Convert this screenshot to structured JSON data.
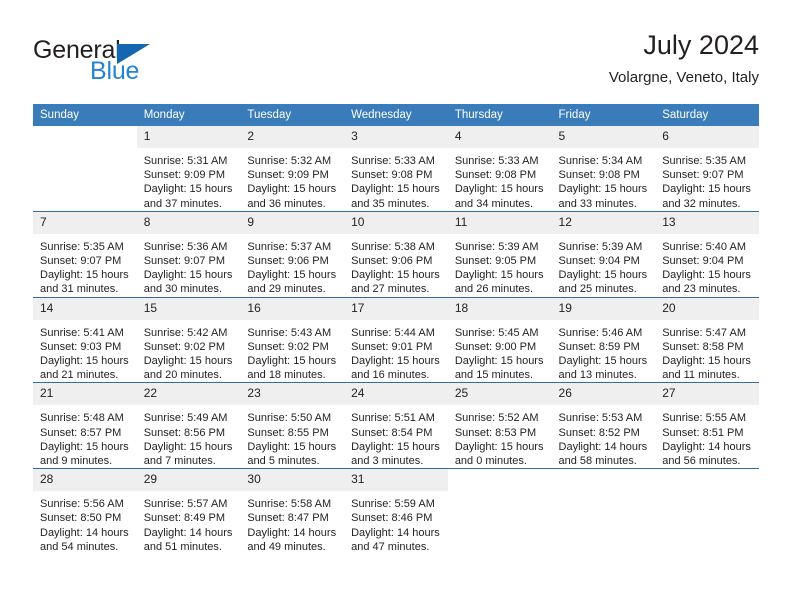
{
  "brand": {
    "name_part1": "General",
    "name_part2": "Blue",
    "triangle_color": "#1565b0",
    "blue_text_color": "#2583d4"
  },
  "header": {
    "title": "July 2024",
    "location": "Volargne, Veneto, Italy"
  },
  "theme": {
    "header_blue": "#3a7cba",
    "separator_blue": "#2f6ca8",
    "daynum_band": "#efefef",
    "text": "#231f20"
  },
  "calendar": {
    "weekday_headers": [
      "Sunday",
      "Monday",
      "Tuesday",
      "Wednesday",
      "Thursday",
      "Friday",
      "Saturday"
    ],
    "labels": {
      "sunrise_prefix": "Sunrise:",
      "sunset_prefix": "Sunset:",
      "daylight_prefix": "Daylight:"
    },
    "weeks": [
      [
        {
          "day": "",
          "empty": true
        },
        {
          "day": "1",
          "sunrise": "Sunrise: 5:31 AM",
          "sunset": "Sunset: 9:09 PM",
          "daylight_line1": "Daylight: 15 hours",
          "daylight_line2": "and 37 minutes."
        },
        {
          "day": "2",
          "sunrise": "Sunrise: 5:32 AM",
          "sunset": "Sunset: 9:09 PM",
          "daylight_line1": "Daylight: 15 hours",
          "daylight_line2": "and 36 minutes."
        },
        {
          "day": "3",
          "sunrise": "Sunrise: 5:33 AM",
          "sunset": "Sunset: 9:08 PM",
          "daylight_line1": "Daylight: 15 hours",
          "daylight_line2": "and 35 minutes."
        },
        {
          "day": "4",
          "sunrise": "Sunrise: 5:33 AM",
          "sunset": "Sunset: 9:08 PM",
          "daylight_line1": "Daylight: 15 hours",
          "daylight_line2": "and 34 minutes."
        },
        {
          "day": "5",
          "sunrise": "Sunrise: 5:34 AM",
          "sunset": "Sunset: 9:08 PM",
          "daylight_line1": "Daylight: 15 hours",
          "daylight_line2": "and 33 minutes."
        },
        {
          "day": "6",
          "sunrise": "Sunrise: 5:35 AM",
          "sunset": "Sunset: 9:07 PM",
          "daylight_line1": "Daylight: 15 hours",
          "daylight_line2": "and 32 minutes."
        }
      ],
      [
        {
          "day": "7",
          "sunrise": "Sunrise: 5:35 AM",
          "sunset": "Sunset: 9:07 PM",
          "daylight_line1": "Daylight: 15 hours",
          "daylight_line2": "and 31 minutes."
        },
        {
          "day": "8",
          "sunrise": "Sunrise: 5:36 AM",
          "sunset": "Sunset: 9:07 PM",
          "daylight_line1": "Daylight: 15 hours",
          "daylight_line2": "and 30 minutes."
        },
        {
          "day": "9",
          "sunrise": "Sunrise: 5:37 AM",
          "sunset": "Sunset: 9:06 PM",
          "daylight_line1": "Daylight: 15 hours",
          "daylight_line2": "and 29 minutes."
        },
        {
          "day": "10",
          "sunrise": "Sunrise: 5:38 AM",
          "sunset": "Sunset: 9:06 PM",
          "daylight_line1": "Daylight: 15 hours",
          "daylight_line2": "and 27 minutes."
        },
        {
          "day": "11",
          "sunrise": "Sunrise: 5:39 AM",
          "sunset": "Sunset: 9:05 PM",
          "daylight_line1": "Daylight: 15 hours",
          "daylight_line2": "and 26 minutes."
        },
        {
          "day": "12",
          "sunrise": "Sunrise: 5:39 AM",
          "sunset": "Sunset: 9:04 PM",
          "daylight_line1": "Daylight: 15 hours",
          "daylight_line2": "and 25 minutes."
        },
        {
          "day": "13",
          "sunrise": "Sunrise: 5:40 AM",
          "sunset": "Sunset: 9:04 PM",
          "daylight_line1": "Daylight: 15 hours",
          "daylight_line2": "and 23 minutes."
        }
      ],
      [
        {
          "day": "14",
          "sunrise": "Sunrise: 5:41 AM",
          "sunset": "Sunset: 9:03 PM",
          "daylight_line1": "Daylight: 15 hours",
          "daylight_line2": "and 21 minutes."
        },
        {
          "day": "15",
          "sunrise": "Sunrise: 5:42 AM",
          "sunset": "Sunset: 9:02 PM",
          "daylight_line1": "Daylight: 15 hours",
          "daylight_line2": "and 20 minutes."
        },
        {
          "day": "16",
          "sunrise": "Sunrise: 5:43 AM",
          "sunset": "Sunset: 9:02 PM",
          "daylight_line1": "Daylight: 15 hours",
          "daylight_line2": "and 18 minutes."
        },
        {
          "day": "17",
          "sunrise": "Sunrise: 5:44 AM",
          "sunset": "Sunset: 9:01 PM",
          "daylight_line1": "Daylight: 15 hours",
          "daylight_line2": "and 16 minutes."
        },
        {
          "day": "18",
          "sunrise": "Sunrise: 5:45 AM",
          "sunset": "Sunset: 9:00 PM",
          "daylight_line1": "Daylight: 15 hours",
          "daylight_line2": "and 15 minutes."
        },
        {
          "day": "19",
          "sunrise": "Sunrise: 5:46 AM",
          "sunset": "Sunset: 8:59 PM",
          "daylight_line1": "Daylight: 15 hours",
          "daylight_line2": "and 13 minutes."
        },
        {
          "day": "20",
          "sunrise": "Sunrise: 5:47 AM",
          "sunset": "Sunset: 8:58 PM",
          "daylight_line1": "Daylight: 15 hours",
          "daylight_line2": "and 11 minutes."
        }
      ],
      [
        {
          "day": "21",
          "sunrise": "Sunrise: 5:48 AM",
          "sunset": "Sunset: 8:57 PM",
          "daylight_line1": "Daylight: 15 hours",
          "daylight_line2": "and 9 minutes."
        },
        {
          "day": "22",
          "sunrise": "Sunrise: 5:49 AM",
          "sunset": "Sunset: 8:56 PM",
          "daylight_line1": "Daylight: 15 hours",
          "daylight_line2": "and 7 minutes."
        },
        {
          "day": "23",
          "sunrise": "Sunrise: 5:50 AM",
          "sunset": "Sunset: 8:55 PM",
          "daylight_line1": "Daylight: 15 hours",
          "daylight_line2": "and 5 minutes."
        },
        {
          "day": "24",
          "sunrise": "Sunrise: 5:51 AM",
          "sunset": "Sunset: 8:54 PM",
          "daylight_line1": "Daylight: 15 hours",
          "daylight_line2": "and 3 minutes."
        },
        {
          "day": "25",
          "sunrise": "Sunrise: 5:52 AM",
          "sunset": "Sunset: 8:53 PM",
          "daylight_line1": "Daylight: 15 hours",
          "daylight_line2": "and 0 minutes."
        },
        {
          "day": "26",
          "sunrise": "Sunrise: 5:53 AM",
          "sunset": "Sunset: 8:52 PM",
          "daylight_line1": "Daylight: 14 hours",
          "daylight_line2": "and 58 minutes."
        },
        {
          "day": "27",
          "sunrise": "Sunrise: 5:55 AM",
          "sunset": "Sunset: 8:51 PM",
          "daylight_line1": "Daylight: 14 hours",
          "daylight_line2": "and 56 minutes."
        }
      ],
      [
        {
          "day": "28",
          "sunrise": "Sunrise: 5:56 AM",
          "sunset": "Sunset: 8:50 PM",
          "daylight_line1": "Daylight: 14 hours",
          "daylight_line2": "and 54 minutes."
        },
        {
          "day": "29",
          "sunrise": "Sunrise: 5:57 AM",
          "sunset": "Sunset: 8:49 PM",
          "daylight_line1": "Daylight: 14 hours",
          "daylight_line2": "and 51 minutes."
        },
        {
          "day": "30",
          "sunrise": "Sunrise: 5:58 AM",
          "sunset": "Sunset: 8:47 PM",
          "daylight_line1": "Daylight: 14 hours",
          "daylight_line2": "and 49 minutes."
        },
        {
          "day": "31",
          "sunrise": "Sunrise: 5:59 AM",
          "sunset": "Sunset: 8:46 PM",
          "daylight_line1": "Daylight: 14 hours",
          "daylight_line2": "and 47 minutes."
        },
        {
          "day": "",
          "empty": true
        },
        {
          "day": "",
          "empty": true
        },
        {
          "day": "",
          "empty": true
        }
      ]
    ]
  }
}
